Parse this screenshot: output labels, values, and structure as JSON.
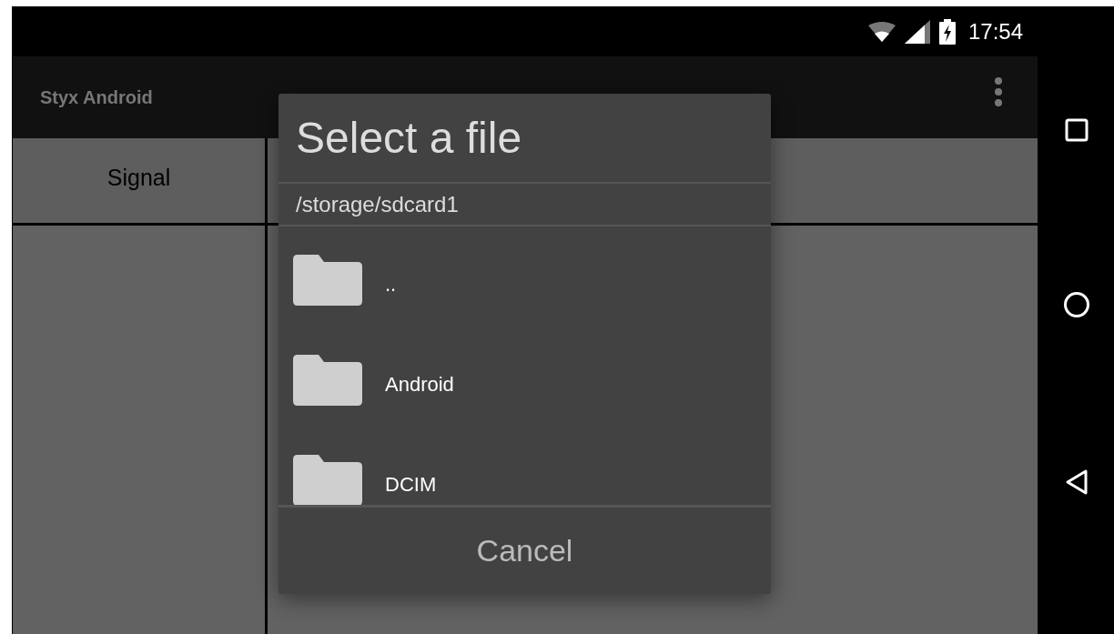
{
  "status_bar": {
    "time": "17:54"
  },
  "app_bar": {
    "title": "Styx Android"
  },
  "tabs": [
    {
      "label": "Signal"
    }
  ],
  "dialog": {
    "title": "Select a file",
    "path": "/storage/sdcard1",
    "items": [
      {
        "name": ".."
      },
      {
        "name": "Android"
      },
      {
        "name": "DCIM"
      }
    ],
    "buttons": [
      "Cancel"
    ]
  }
}
